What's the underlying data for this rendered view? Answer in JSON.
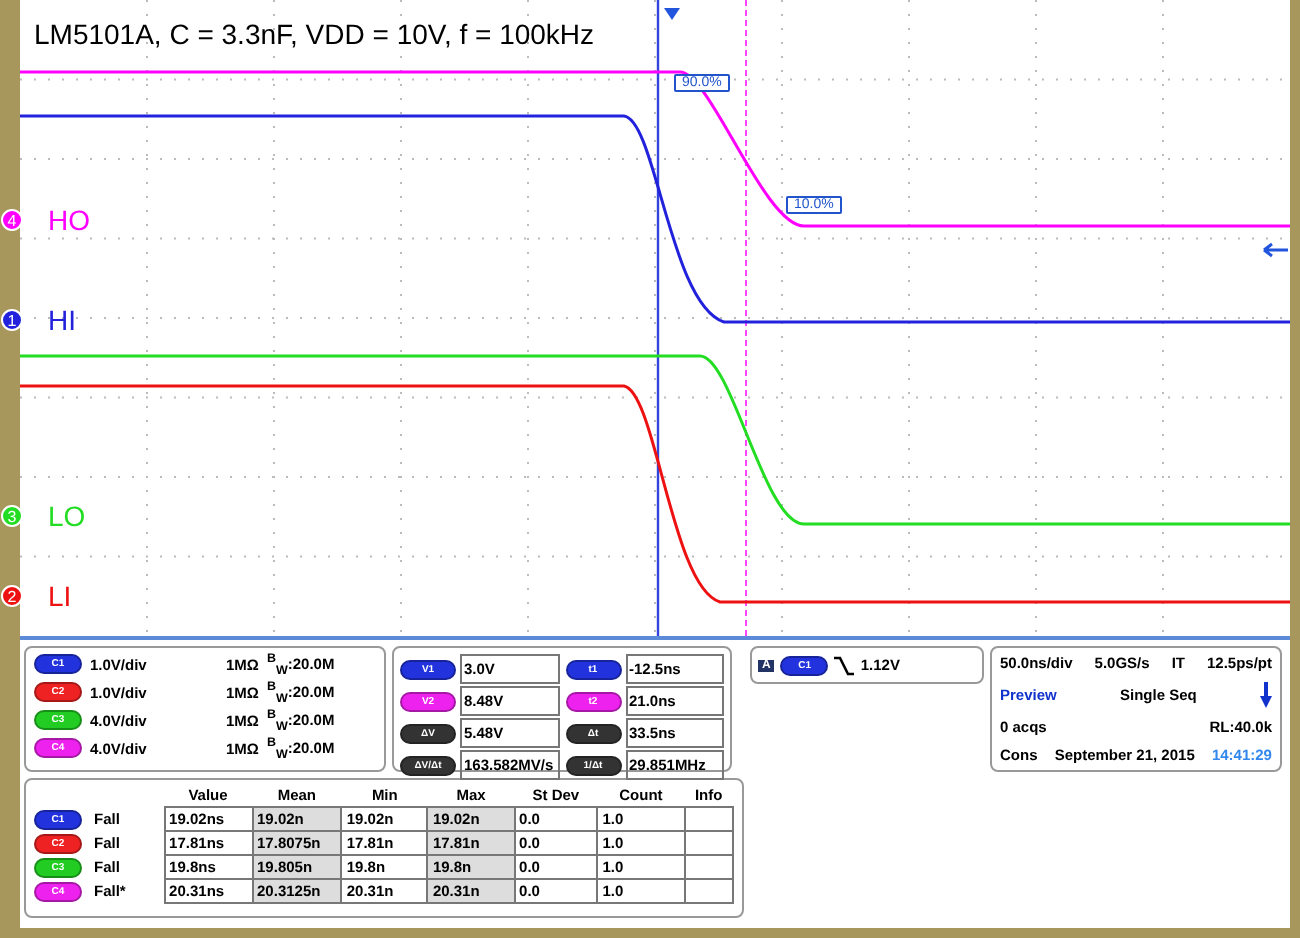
{
  "title": "LM5101A, C = 3.3nF, VDD = 10V, f = 100kHz",
  "traces": [
    {
      "label": "HO",
      "channel": "4",
      "color": "#ff00ff"
    },
    {
      "label": "HI",
      "channel": "1",
      "color": "#2222dd"
    },
    {
      "label": "LO",
      "channel": "3",
      "color": "#22dd22"
    },
    {
      "label": "LI",
      "channel": "2",
      "color": "#ee1111"
    }
  ],
  "cursor_labels": [
    "90.0%",
    "10.0%"
  ],
  "channels": [
    {
      "chip": "C1",
      "color": "#2233dd",
      "scale": "1.0V/div",
      "impedance": "1MΩ",
      "bandwidth": "$^{B}$$_{W}$:20.0M"
    },
    {
      "chip": "C2",
      "color": "#ee2222",
      "scale": "1.0V/div",
      "impedance": "1MΩ",
      "bandwidth": "$^{B}$$_{W}$:20.0M"
    },
    {
      "chip": "C3",
      "color": "#22cc22",
      "scale": "4.0V/div",
      "impedance": "1MΩ",
      "bandwidth": "$^{B}$$_{W}$:20.0M"
    },
    {
      "chip": "C4",
      "color": "#ee22ee",
      "scale": "4.0V/div",
      "impedance": "1MΩ",
      "bandwidth": "$^{B}$$_{W}$:20.0M"
    }
  ],
  "cursors": [
    {
      "chip": "V1",
      "color": "#2233dd",
      "value": "3.0V"
    },
    {
      "chip": "t1",
      "color": "#2233dd",
      "value": "-12.5ns"
    },
    {
      "chip": "V2",
      "color": "#ee22ee",
      "value": "8.48V"
    },
    {
      "chip": "t2",
      "color": "#ee22ee",
      "value": "21.0ns"
    },
    {
      "chip": "ΔV",
      "color": "#333333",
      "value": "5.48V"
    },
    {
      "chip": "Δt",
      "color": "#333333",
      "value": "33.5ns"
    },
    {
      "chip": "ΔV/Δt",
      "color": "#333333",
      "value": "163.582MV/s"
    },
    {
      "chip": "1/Δt",
      "color": "#333333",
      "value": "29.851MHz"
    }
  ],
  "trigger": {
    "mode": "A",
    "chip": "C1",
    "color": "#2233dd",
    "level": "1.12V"
  },
  "acquisition": {
    "timebase": "50.0ns/div",
    "sample_rate": "5.0GS/s",
    "mode": "IT",
    "resolution": "12.5ps/pt",
    "status": "Preview",
    "run_mode": "Single Seq",
    "acqs": "0 acqs",
    "record_length": "RL:40.0k",
    "source": "Cons",
    "date": "September 21, 2015",
    "time": "14:41:29"
  },
  "measurements": {
    "columns": [
      "Value",
      "Mean",
      "Min",
      "Max",
      "St Dev",
      "Count",
      "Info"
    ],
    "rows": [
      {
        "chip": "C1",
        "color": "#2233dd",
        "type": "Fall",
        "cells": [
          "19.02ns",
          "19.02n",
          "19.02n",
          "19.02n",
          "0.0",
          "1.0"
        ]
      },
      {
        "chip": "C2",
        "color": "#ee2222",
        "type": "Fall",
        "cells": [
          "17.81ns",
          "17.8075n",
          "17.81n",
          "17.81n",
          "0.0",
          "1.0"
        ]
      },
      {
        "chip": "C3",
        "color": "#22cc22",
        "type": "Fall",
        "cells": [
          "19.8ns",
          "19.805n",
          "19.8n",
          "19.8n",
          "0.0",
          "1.0"
        ]
      },
      {
        "chip": "C4",
        "color": "#ee22ee",
        "type": "Fall*",
        "cells": [
          "20.31ns",
          "20.3125n",
          "20.31n",
          "20.31n",
          "0.0",
          "1.0"
        ]
      }
    ]
  }
}
